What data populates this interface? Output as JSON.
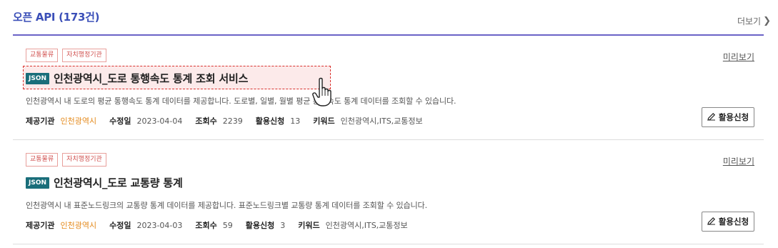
{
  "header": {
    "title": "오픈 API (173건)",
    "more_label": "더보기",
    "more_icon": "chevron-right-icon"
  },
  "colors": {
    "accent": "#3b4fb8",
    "rule": "#6b63c7",
    "tag_red": "#d0514f",
    "json_badge": "#1a6e7a",
    "org_orange": "#e48a1c",
    "highlight_red": "#d9322e"
  },
  "cards": [
    {
      "tags": [
        "교통물류",
        "자치행정기관"
      ],
      "preview_label": "미리보기",
      "badge": "JSON",
      "title": "인천광역시_도로 통행속도 통계 조회 서비스",
      "description": "인천광역시 내 도로의 평균 통행속도 통계 데이터를 제공합니다. 도로별, 일별, 월별 평균 통행속도 통계 데이터를 조회할 수 있습니다.",
      "meta": {
        "provider_label": "제공기관",
        "provider": "인천광역시",
        "modified_label": "수정일",
        "modified": "2023-04-04",
        "views_label": "조회수",
        "views": "2239",
        "applications_label": "활용신청",
        "applications": "13",
        "keywords_label": "키워드",
        "keywords": "인천광역시,ITS,교통정보"
      },
      "apply_label": "활용신청",
      "highlighted": true
    },
    {
      "tags": [
        "교통물류",
        "자치행정기관"
      ],
      "preview_label": "미리보기",
      "badge": "JSON",
      "title": "인천광역시_도로 교통량 통계",
      "description": "인천광역시 내 표준노드링크의 교통량 통계 데이터를 제공합니다. 표준노드링크별 교통량 통계 데이터를 조회할 수 있습니다.",
      "meta": {
        "provider_label": "제공기관",
        "provider": "인천광역시",
        "modified_label": "수정일",
        "modified": "2023-04-03",
        "views_label": "조회수",
        "views": "59",
        "applications_label": "활용신청",
        "applications": "3",
        "keywords_label": "키워드",
        "keywords": "인천광역시,ITS,교통정보"
      },
      "apply_label": "활용신청",
      "highlighted": false
    }
  ]
}
